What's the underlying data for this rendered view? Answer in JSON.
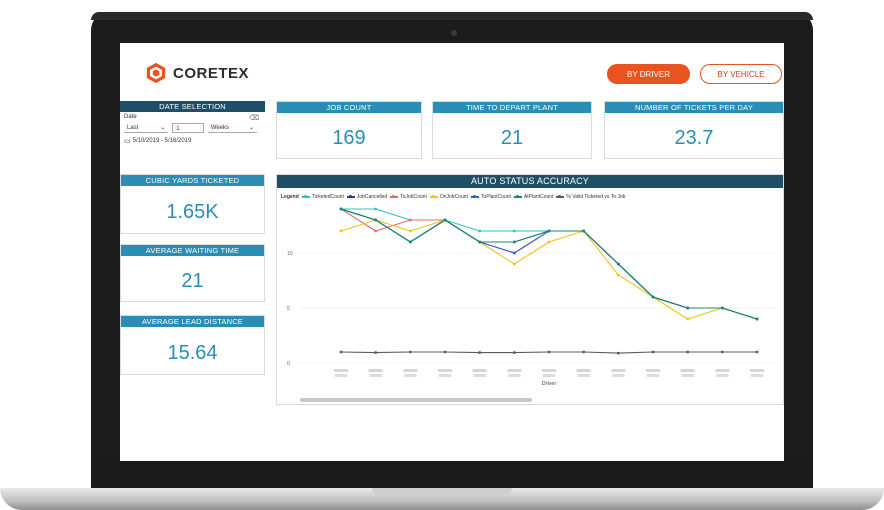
{
  "brand": {
    "name": "CORETEX"
  },
  "nav": {
    "by_driver": "BY DRIVER",
    "by_vehicle": "BY VEHICLE"
  },
  "date_selection": {
    "title": "DATE SELECTION",
    "field_label": "Date",
    "relative": "Last",
    "amount": "1",
    "unit": "Weeks",
    "range": "5/10/2019 - 5/16/2019"
  },
  "kpis": {
    "job_count": {
      "title": "JOB COUNT",
      "value": "169"
    },
    "time_to_depart": {
      "title": "TIME TO DEPART PLANT",
      "value": "21"
    },
    "tickets_per_day": {
      "title": "NUMBER OF TICKETS PER DAY",
      "value": "23.7"
    },
    "cubic_yards": {
      "title": "CUBIC YARDS TICKETED",
      "value": "1.65K"
    },
    "waiting_time": {
      "title": "AVERAGE WAITING TIME",
      "value": "21"
    },
    "lead_distance": {
      "title": "AVERAGE LEAD DISTANCE",
      "value": "15.64"
    }
  },
  "colors": {
    "accent": "#e8531f",
    "header": "#2a8db5",
    "header_dark": "#1f4e66"
  },
  "chart_data": {
    "type": "line",
    "title": "AUTO STATUS ACCURACY",
    "legend_title": "Legend",
    "xlabel": "Driver",
    "ylabel": "",
    "ylim": [
      0,
      14
    ],
    "yticks": [
      0,
      5,
      10
    ],
    "grid": true,
    "legend_position": "top",
    "categories": [
      "",
      "",
      "",
      "",
      "",
      "",
      "",
      "",
      "",
      "",
      "",
      "",
      ""
    ],
    "series": [
      {
        "name": "TicketedCount",
        "color": "#2ec4b6",
        "values": [
          14,
          14,
          13,
          13,
          12,
          12,
          12,
          12,
          9,
          6,
          5,
          5,
          4
        ]
      },
      {
        "name": "JobCancelled",
        "color": "#1d3f8f",
        "values": [
          14,
          13,
          11,
          13,
          11,
          11,
          12,
          12,
          9,
          6,
          5,
          5,
          4
        ]
      },
      {
        "name": "ToJobCount",
        "color": "#e36b6b",
        "values": [
          14,
          12,
          13,
          13,
          11,
          10,
          12,
          12,
          9,
          6,
          5,
          5,
          4
        ]
      },
      {
        "name": "OnJobCount",
        "color": "#f2c318",
        "values": [
          12,
          13,
          12,
          13,
          11,
          9,
          11,
          12,
          8,
          6,
          4,
          5,
          4
        ]
      },
      {
        "name": "ToPlantCount",
        "color": "#2b63c9",
        "values": [
          14,
          13,
          11,
          13,
          11,
          10,
          12,
          12,
          9,
          6,
          5,
          5,
          4
        ]
      },
      {
        "name": "AtPlantCount",
        "color": "#138a78",
        "values": [
          14,
          13,
          11,
          13,
          11,
          11,
          12,
          12,
          9,
          6,
          5,
          5,
          4
        ]
      },
      {
        "name": "% Valid Ticketed vs To Job",
        "color": "#555a66",
        "values": [
          1,
          0.95,
          1,
          1,
          0.95,
          0.95,
          1,
          1,
          0.9,
          1,
          1,
          1,
          1
        ]
      }
    ]
  }
}
